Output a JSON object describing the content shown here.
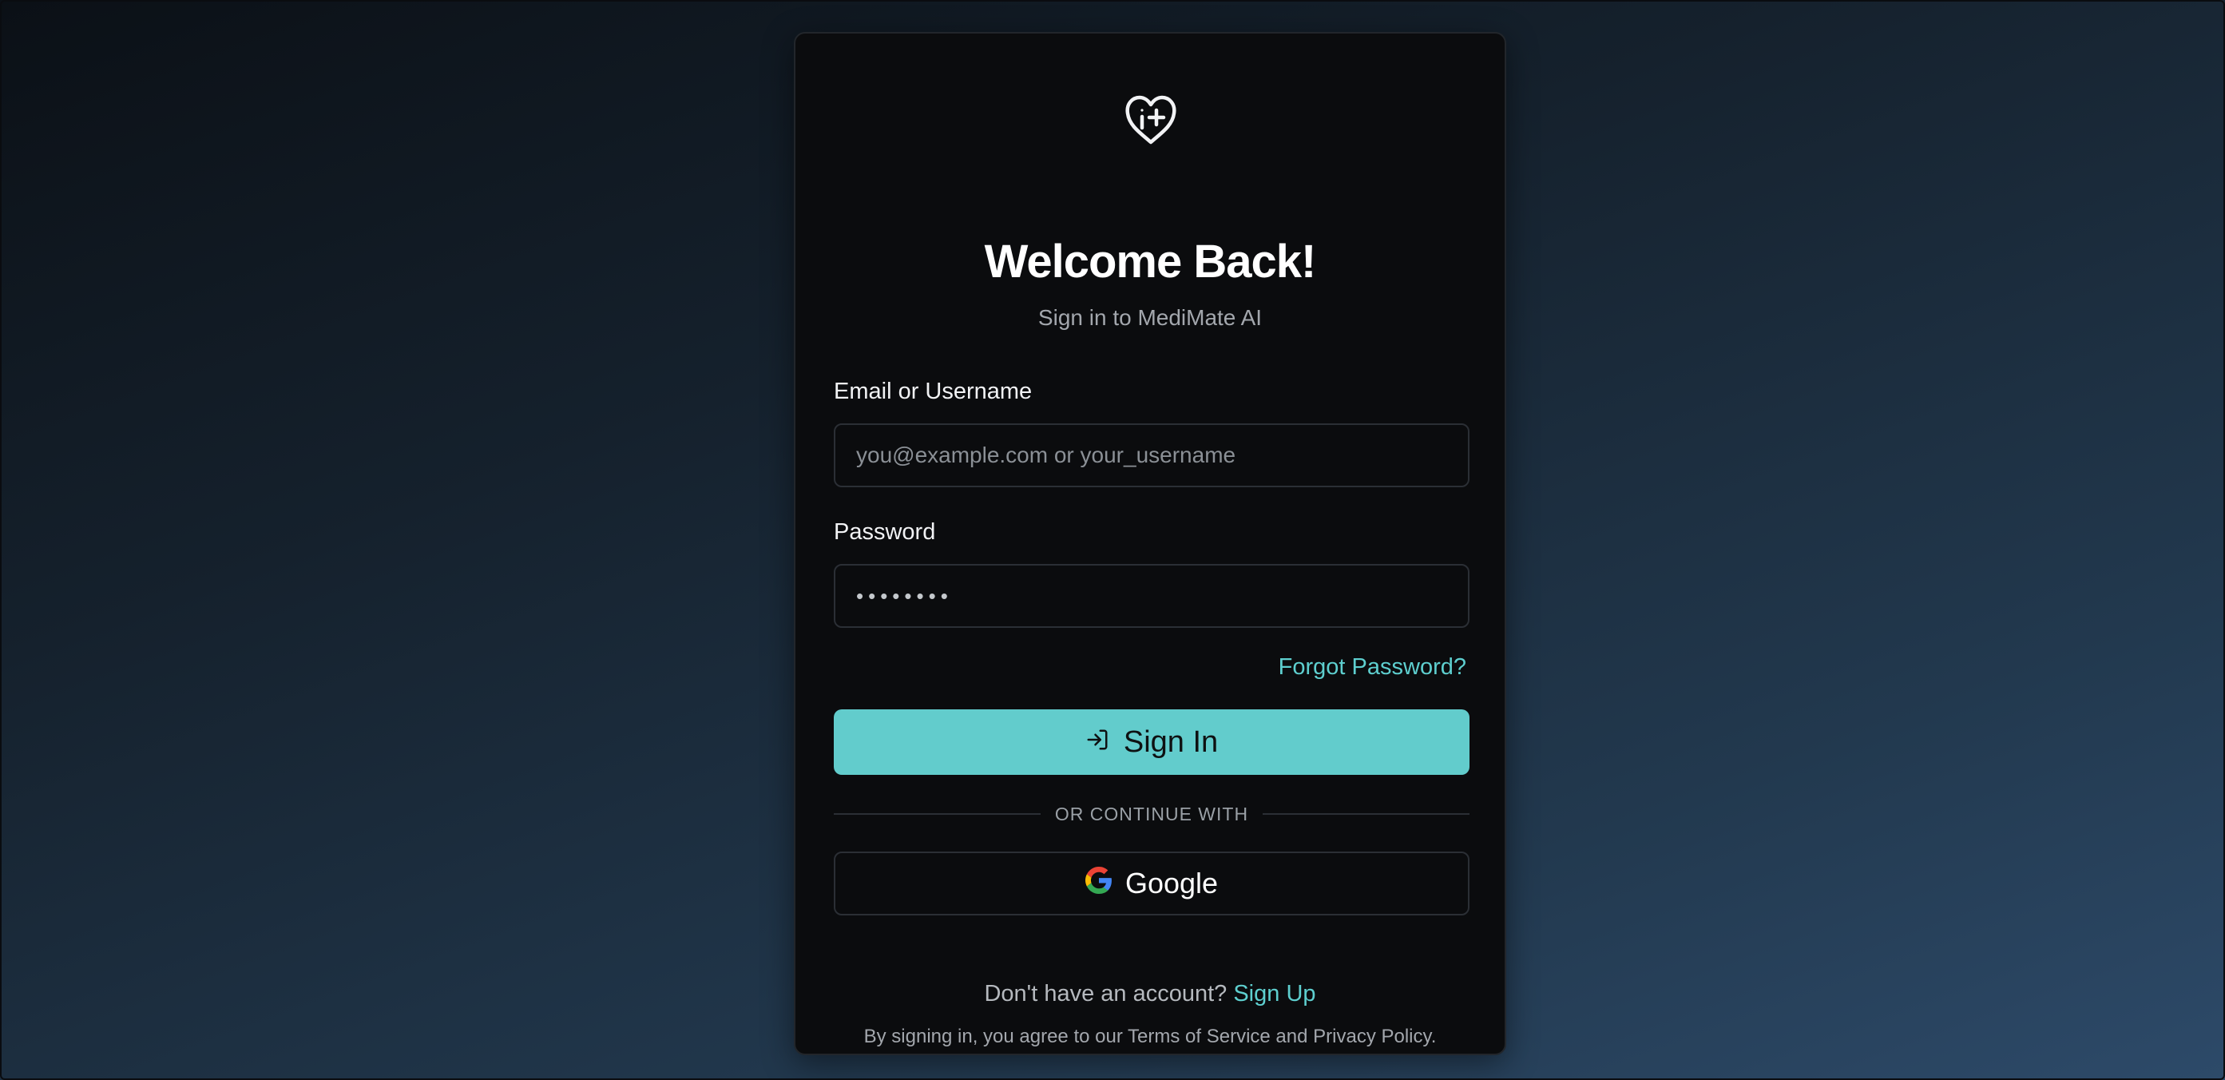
{
  "colors": {
    "accent": "#62cccc",
    "link": "#5ecfcf",
    "card_background": "#0b0c0e",
    "page_background": "#1c2c3c"
  },
  "logo": {
    "icon": "heart-medical-info-icon"
  },
  "header": {
    "title": "Welcome Back!",
    "subtitle": "Sign in to MediMate AI"
  },
  "form": {
    "email_label": "Email or Username",
    "email_placeholder": "you@example.com or your_username",
    "password_label": "Password",
    "password_value": "••••••••",
    "forgot_label": "Forgot Password?",
    "signin_label": "Sign In",
    "signin_icon": "sign-in-arrow-icon"
  },
  "divider": {
    "text": "OR CONTINUE WITH"
  },
  "oauth": {
    "google_label": "Google",
    "google_icon": "google-g-icon"
  },
  "footer": {
    "no_account_text": "Don't have an account?",
    "signup_label": "Sign Up",
    "terms_text": "By signing in, you agree to our Terms of Service and Privacy Policy."
  }
}
